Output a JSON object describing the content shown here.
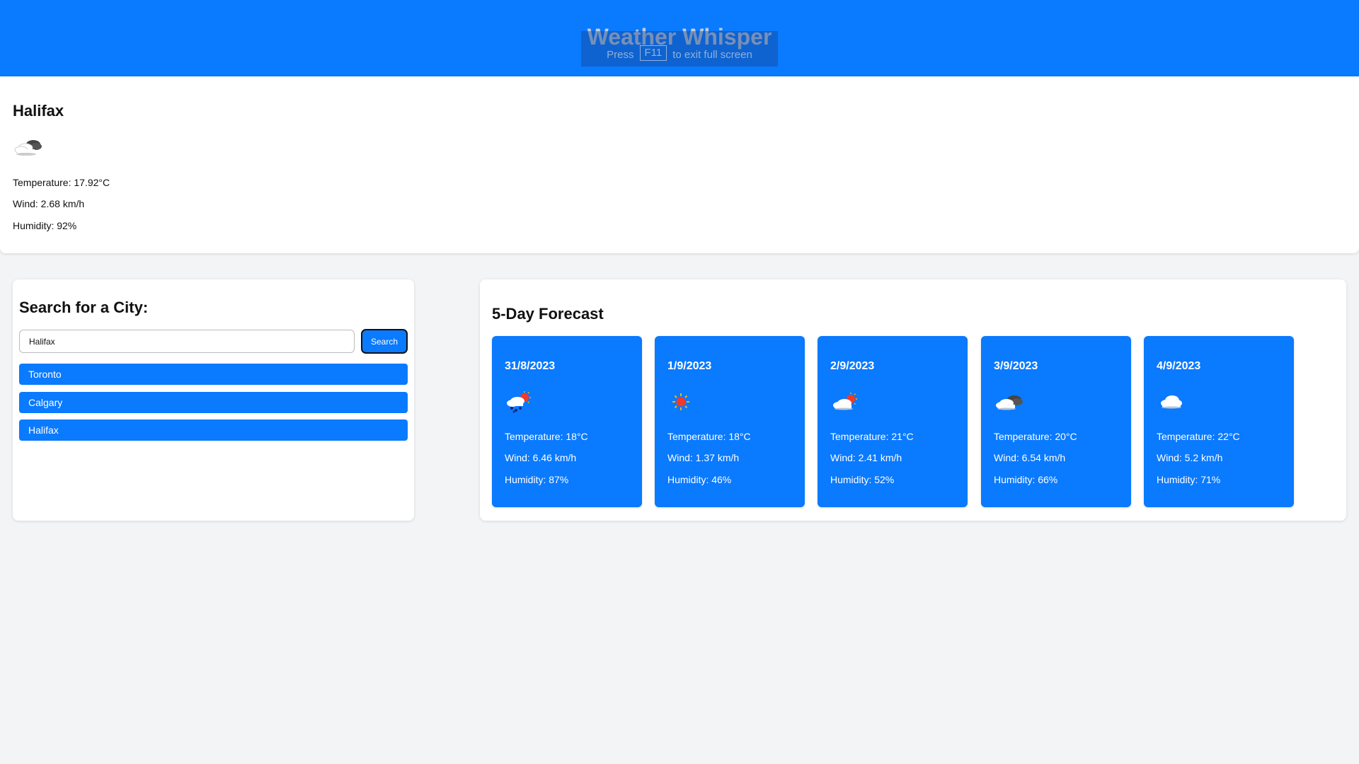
{
  "header": {
    "title": "Weather Whisper",
    "fullscreen_hint": {
      "prefix": "Press",
      "key": "F11",
      "suffix": "to exit full screen"
    }
  },
  "current": {
    "city": "Halifax",
    "icon": "clouds-icon",
    "temperature": "Temperature: 17.92°C",
    "wind": "Wind: 2.68 km/h",
    "humidity": "Humidity: 92%"
  },
  "search": {
    "title": "Search for a City:",
    "input_value": "Halifax",
    "button_label": "Search",
    "history": [
      "Toronto",
      "Calgary",
      "Halifax"
    ]
  },
  "forecast": {
    "title": "5-Day Forecast",
    "days": [
      {
        "date": "31/8/2023",
        "icon": "rain-icon",
        "temperature": "Temperature: 18°C",
        "wind": "Wind: 6.46 km/h",
        "humidity": "Humidity: 87%"
      },
      {
        "date": "1/9/2023",
        "icon": "sun-icon",
        "temperature": "Temperature: 18°C",
        "wind": "Wind: 1.37 km/h",
        "humidity": "Humidity: 46%"
      },
      {
        "date": "2/9/2023",
        "icon": "partly-cloudy-icon",
        "temperature": "Temperature: 21°C",
        "wind": "Wind: 2.41 km/h",
        "humidity": "Humidity: 52%"
      },
      {
        "date": "3/9/2023",
        "icon": "broken-clouds-icon",
        "temperature": "Temperature: 20°C",
        "wind": "Wind: 6.54 km/h",
        "humidity": "Humidity: 66%"
      },
      {
        "date": "4/9/2023",
        "icon": "cloud-icon",
        "temperature": "Temperature: 22°C",
        "wind": "Wind: 5.2 km/h",
        "humidity": "Humidity: 71%"
      }
    ]
  },
  "colors": {
    "primary": "#0a7aff",
    "background": "#f3f4f6",
    "card": "#ffffff"
  }
}
